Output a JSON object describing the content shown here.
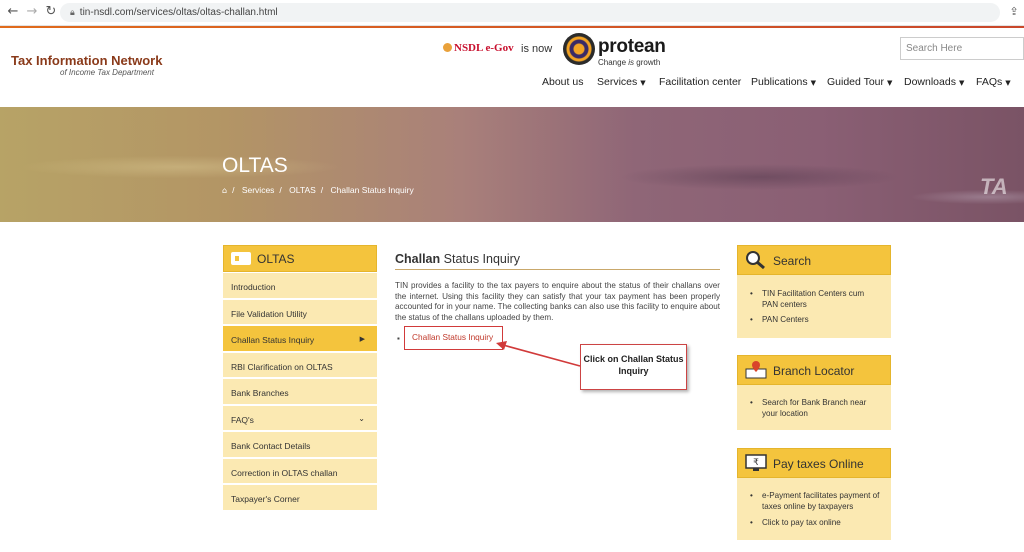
{
  "browser": {
    "back_icon": "arrow-left-icon",
    "forward_icon": "arrow-right-icon",
    "reload_icon": "reload-icon",
    "url": "tin-nsdl.com/services/oltas/oltas-challan.html",
    "share_icon": "share-icon"
  },
  "header": {
    "logo_title": "Tax Information Network",
    "logo_subtitle": "of Income Tax Department",
    "nsdl": "NSDL e-Gov",
    "is_now": "is now",
    "brand": "protean",
    "tagline_1": "Change ",
    "tagline_is": "is",
    "tagline_2": " growth",
    "search_placeholder": "Search Here"
  },
  "menu": {
    "about": "About us",
    "services": "Services",
    "facilitation": "Facilitation center",
    "publications": "Publications",
    "guided": "Guided Tour",
    "downloads": "Downloads",
    "faqs": "FAQs"
  },
  "banner": {
    "title": "OLTAS",
    "crumb_home_icon": "home-icon",
    "crumb_sep": "/",
    "crumb_1": "Services",
    "crumb_2": "OLTAS",
    "crumb_3": "Challan Status Inquiry",
    "bg_word": "TA"
  },
  "sidebar": {
    "title": "OLTAS",
    "items": [
      "Introduction",
      "File Validation Utility",
      "Challan Status Inquiry",
      "RBI Clarification on OLTAS",
      "Bank Branches",
      "FAQ's",
      "Bank Contact Details",
      "Correction in OLTAS challan",
      "Taxpayer's Corner"
    ],
    "active_index": 2
  },
  "main": {
    "title_bold": "Challan",
    "title_rest": " Status Inquiry",
    "paragraph": "TIN provides a facility to the tax payers to enquire about the status of their challans over the internet. Using this facility they can satisfy that your tax payment has been properly accounted for in your name. The collecting banks can also use this facility to enquire about the status of the challans uploaded by them.",
    "link": "Challan Status Inquiry",
    "callout": "Click on Challan Status Inquiry"
  },
  "right": {
    "search": {
      "title": "Search",
      "icon": "magnifier-icon",
      "items": [
        "TIN Facilitation Centers cum PAN centers",
        "PAN Centers"
      ]
    },
    "branch": {
      "title": "Branch Locator",
      "icon": "map-pin-icon",
      "items": [
        "Search for Bank Branch near your location"
      ]
    },
    "pay": {
      "title": "Pay taxes Online",
      "icon": "monitor-icon",
      "items": [
        "e-Payment facilitates payment of taxes online by taxpayers",
        "Click to pay tax online"
      ]
    }
  },
  "colors": {
    "accent_yellow": "#f4c43d",
    "light_yellow": "#fbe9b2",
    "link_red": "#c0392b",
    "header_orange": "#e06b1c"
  }
}
